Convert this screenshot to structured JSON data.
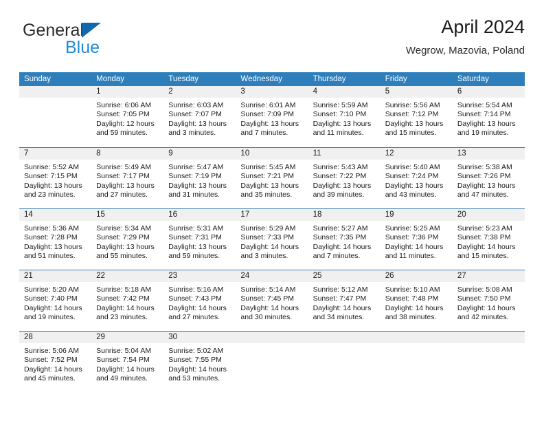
{
  "brand": {
    "name_dark": "General",
    "name_light": "Blue",
    "logo_icon": "triangle-logo-icon"
  },
  "header": {
    "title": "April 2024",
    "subtitle": "Wegrow, Mazovia, Poland"
  },
  "colors": {
    "header_blue": "#2e7ebb",
    "row_divider_blue": "#3a7cb4",
    "day_band_gray": "#f0f0f0",
    "brand_blue": "#1f8bd6",
    "logo_blue": "#1368ad"
  },
  "weekdays": [
    "Sunday",
    "Monday",
    "Tuesday",
    "Wednesday",
    "Thursday",
    "Friday",
    "Saturday"
  ],
  "labels": {
    "sunrise_prefix": "Sunrise:",
    "sunset_prefix": "Sunset:",
    "daylight_prefix": "Daylight:"
  },
  "weeks": [
    [
      {
        "day": "",
        "empty": true
      },
      {
        "day": "1",
        "sunrise": "Sunrise: 6:06 AM",
        "sunset": "Sunset: 7:05 PM",
        "daylight_l1": "Daylight: 12 hours",
        "daylight_l2": "and 59 minutes."
      },
      {
        "day": "2",
        "sunrise": "Sunrise: 6:03 AM",
        "sunset": "Sunset: 7:07 PM",
        "daylight_l1": "Daylight: 13 hours",
        "daylight_l2": "and 3 minutes."
      },
      {
        "day": "3",
        "sunrise": "Sunrise: 6:01 AM",
        "sunset": "Sunset: 7:09 PM",
        "daylight_l1": "Daylight: 13 hours",
        "daylight_l2": "and 7 minutes."
      },
      {
        "day": "4",
        "sunrise": "Sunrise: 5:59 AM",
        "sunset": "Sunset: 7:10 PM",
        "daylight_l1": "Daylight: 13 hours",
        "daylight_l2": "and 11 minutes."
      },
      {
        "day": "5",
        "sunrise": "Sunrise: 5:56 AM",
        "sunset": "Sunset: 7:12 PM",
        "daylight_l1": "Daylight: 13 hours",
        "daylight_l2": "and 15 minutes."
      },
      {
        "day": "6",
        "sunrise": "Sunrise: 5:54 AM",
        "sunset": "Sunset: 7:14 PM",
        "daylight_l1": "Daylight: 13 hours",
        "daylight_l2": "and 19 minutes."
      }
    ],
    [
      {
        "day": "7",
        "sunrise": "Sunrise: 5:52 AM",
        "sunset": "Sunset: 7:15 PM",
        "daylight_l1": "Daylight: 13 hours",
        "daylight_l2": "and 23 minutes."
      },
      {
        "day": "8",
        "sunrise": "Sunrise: 5:49 AM",
        "sunset": "Sunset: 7:17 PM",
        "daylight_l1": "Daylight: 13 hours",
        "daylight_l2": "and 27 minutes."
      },
      {
        "day": "9",
        "sunrise": "Sunrise: 5:47 AM",
        "sunset": "Sunset: 7:19 PM",
        "daylight_l1": "Daylight: 13 hours",
        "daylight_l2": "and 31 minutes."
      },
      {
        "day": "10",
        "sunrise": "Sunrise: 5:45 AM",
        "sunset": "Sunset: 7:21 PM",
        "daylight_l1": "Daylight: 13 hours",
        "daylight_l2": "and 35 minutes."
      },
      {
        "day": "11",
        "sunrise": "Sunrise: 5:43 AM",
        "sunset": "Sunset: 7:22 PM",
        "daylight_l1": "Daylight: 13 hours",
        "daylight_l2": "and 39 minutes."
      },
      {
        "day": "12",
        "sunrise": "Sunrise: 5:40 AM",
        "sunset": "Sunset: 7:24 PM",
        "daylight_l1": "Daylight: 13 hours",
        "daylight_l2": "and 43 minutes."
      },
      {
        "day": "13",
        "sunrise": "Sunrise: 5:38 AM",
        "sunset": "Sunset: 7:26 PM",
        "daylight_l1": "Daylight: 13 hours",
        "daylight_l2": "and 47 minutes."
      }
    ],
    [
      {
        "day": "14",
        "sunrise": "Sunrise: 5:36 AM",
        "sunset": "Sunset: 7:28 PM",
        "daylight_l1": "Daylight: 13 hours",
        "daylight_l2": "and 51 minutes."
      },
      {
        "day": "15",
        "sunrise": "Sunrise: 5:34 AM",
        "sunset": "Sunset: 7:29 PM",
        "daylight_l1": "Daylight: 13 hours",
        "daylight_l2": "and 55 minutes."
      },
      {
        "day": "16",
        "sunrise": "Sunrise: 5:31 AM",
        "sunset": "Sunset: 7:31 PM",
        "daylight_l1": "Daylight: 13 hours",
        "daylight_l2": "and 59 minutes."
      },
      {
        "day": "17",
        "sunrise": "Sunrise: 5:29 AM",
        "sunset": "Sunset: 7:33 PM",
        "daylight_l1": "Daylight: 14 hours",
        "daylight_l2": "and 3 minutes."
      },
      {
        "day": "18",
        "sunrise": "Sunrise: 5:27 AM",
        "sunset": "Sunset: 7:35 PM",
        "daylight_l1": "Daylight: 14 hours",
        "daylight_l2": "and 7 minutes."
      },
      {
        "day": "19",
        "sunrise": "Sunrise: 5:25 AM",
        "sunset": "Sunset: 7:36 PM",
        "daylight_l1": "Daylight: 14 hours",
        "daylight_l2": "and 11 minutes."
      },
      {
        "day": "20",
        "sunrise": "Sunrise: 5:23 AM",
        "sunset": "Sunset: 7:38 PM",
        "daylight_l1": "Daylight: 14 hours",
        "daylight_l2": "and 15 minutes."
      }
    ],
    [
      {
        "day": "21",
        "sunrise": "Sunrise: 5:20 AM",
        "sunset": "Sunset: 7:40 PM",
        "daylight_l1": "Daylight: 14 hours",
        "daylight_l2": "and 19 minutes."
      },
      {
        "day": "22",
        "sunrise": "Sunrise: 5:18 AM",
        "sunset": "Sunset: 7:42 PM",
        "daylight_l1": "Daylight: 14 hours",
        "daylight_l2": "and 23 minutes."
      },
      {
        "day": "23",
        "sunrise": "Sunrise: 5:16 AM",
        "sunset": "Sunset: 7:43 PM",
        "daylight_l1": "Daylight: 14 hours",
        "daylight_l2": "and 27 minutes."
      },
      {
        "day": "24",
        "sunrise": "Sunrise: 5:14 AM",
        "sunset": "Sunset: 7:45 PM",
        "daylight_l1": "Daylight: 14 hours",
        "daylight_l2": "and 30 minutes."
      },
      {
        "day": "25",
        "sunrise": "Sunrise: 5:12 AM",
        "sunset": "Sunset: 7:47 PM",
        "daylight_l1": "Daylight: 14 hours",
        "daylight_l2": "and 34 minutes."
      },
      {
        "day": "26",
        "sunrise": "Sunrise: 5:10 AM",
        "sunset": "Sunset: 7:48 PM",
        "daylight_l1": "Daylight: 14 hours",
        "daylight_l2": "and 38 minutes."
      },
      {
        "day": "27",
        "sunrise": "Sunrise: 5:08 AM",
        "sunset": "Sunset: 7:50 PM",
        "daylight_l1": "Daylight: 14 hours",
        "daylight_l2": "and 42 minutes."
      }
    ],
    [
      {
        "day": "28",
        "sunrise": "Sunrise: 5:06 AM",
        "sunset": "Sunset: 7:52 PM",
        "daylight_l1": "Daylight: 14 hours",
        "daylight_l2": "and 45 minutes."
      },
      {
        "day": "29",
        "sunrise": "Sunrise: 5:04 AM",
        "sunset": "Sunset: 7:54 PM",
        "daylight_l1": "Daylight: 14 hours",
        "daylight_l2": "and 49 minutes."
      },
      {
        "day": "30",
        "sunrise": "Sunrise: 5:02 AM",
        "sunset": "Sunset: 7:55 PM",
        "daylight_l1": "Daylight: 14 hours",
        "daylight_l2": "and 53 minutes."
      },
      {
        "day": "",
        "empty": true
      },
      {
        "day": "",
        "empty": true
      },
      {
        "day": "",
        "empty": true
      },
      {
        "day": "",
        "empty": true
      }
    ]
  ]
}
